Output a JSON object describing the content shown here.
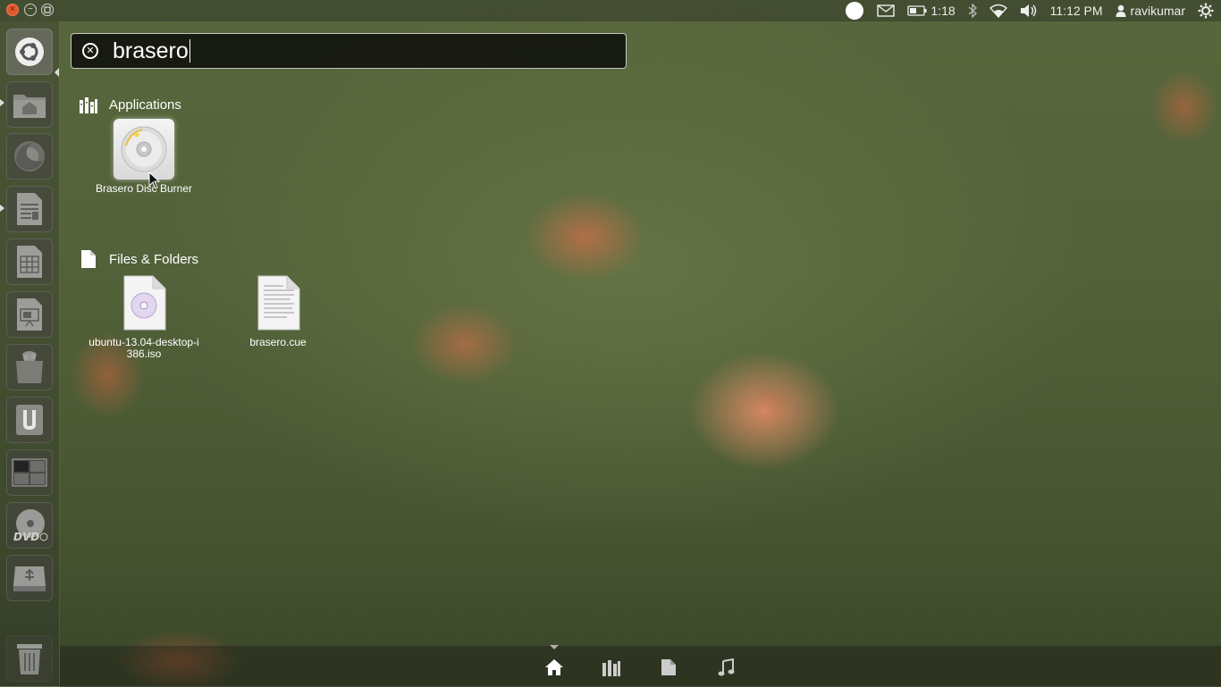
{
  "top_panel": {
    "battery_time": "1:18",
    "clock": "11:12 PM",
    "username": "ravikumar"
  },
  "search": {
    "query": "brasero"
  },
  "sections": {
    "applications": {
      "title": "Applications",
      "items": [
        {
          "label": "Brasero Disc Burner",
          "icon": "disc-burner-icon"
        }
      ]
    },
    "files": {
      "title": "Files & Folders",
      "items": [
        {
          "label": "ubuntu-13.04-desktop-i386.iso",
          "icon": "disc-image-file-icon"
        },
        {
          "label": "brasero.cue",
          "icon": "text-file-icon"
        }
      ]
    }
  },
  "launcher": {
    "items": [
      {
        "name": "dash-home",
        "icon": "ubuntu-logo-icon"
      },
      {
        "name": "home-folder",
        "icon": "folder-icon"
      },
      {
        "name": "firefox",
        "icon": "firefox-icon"
      },
      {
        "name": "libreoffice-writer",
        "icon": "writer-icon"
      },
      {
        "name": "libreoffice-calc",
        "icon": "calc-icon"
      },
      {
        "name": "libreoffice-impress",
        "icon": "impress-icon"
      },
      {
        "name": "software-center",
        "icon": "shopping-bag-icon"
      },
      {
        "name": "ubuntu-one",
        "icon": "ubuntu-one-icon"
      },
      {
        "name": "workspace-switcher",
        "icon": "workspaces-icon"
      },
      {
        "name": "dvd-drive",
        "icon": "dvd-icon"
      },
      {
        "name": "usb-drive",
        "icon": "usb-drive-icon"
      },
      {
        "name": "trash",
        "icon": "trash-icon"
      }
    ]
  },
  "lenses": [
    {
      "name": "home",
      "icon": "home-icon"
    },
    {
      "name": "applications",
      "icon": "applications-icon"
    },
    {
      "name": "files",
      "icon": "file-icon"
    },
    {
      "name": "music",
      "icon": "music-note-icon"
    }
  ],
  "colors": {
    "close_button": "#e15a2f",
    "search_background": "#0a0a08"
  }
}
